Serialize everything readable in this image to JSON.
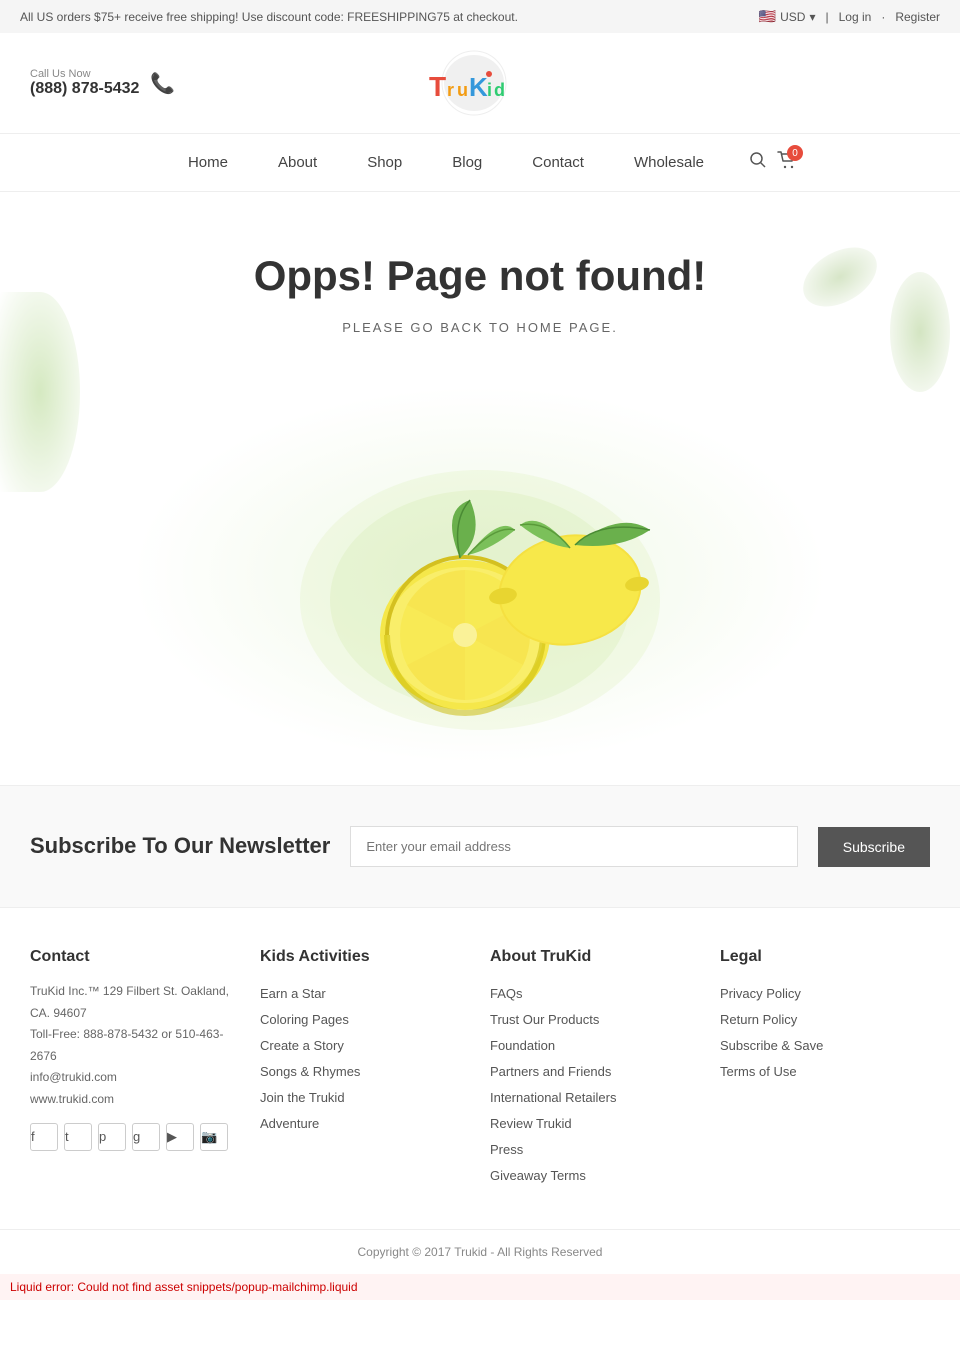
{
  "topbar": {
    "promo_text": "All US orders $75+ receive free shipping! Use discount code: FREESHIPPING75 at checkout.",
    "currency": "USD",
    "login_label": "Log in",
    "register_label": "Register"
  },
  "header": {
    "call_label": "Call Us Now",
    "phone": "(888) 878-5432"
  },
  "nav": {
    "items": [
      {
        "label": "Home",
        "href": "#"
      },
      {
        "label": "About",
        "href": "#"
      },
      {
        "label": "Shop",
        "href": "#"
      },
      {
        "label": "Blog",
        "href": "#"
      },
      {
        "label": "Contact",
        "href": "#"
      },
      {
        "label": "Wholesale",
        "href": "#"
      }
    ],
    "cart_count": "0"
  },
  "error_page": {
    "title": "Opps! Page not found!",
    "subtitle": "PLEASE GO BACK TO HOME PAGE."
  },
  "newsletter": {
    "title": "Subscribe To Our Newsletter",
    "input_placeholder": "Enter your email address",
    "button_label": "Subscribe"
  },
  "footer": {
    "contact": {
      "heading": "Contact",
      "address": "TruKid Inc.™ 129 Filbert St. Oakland, CA. 94607",
      "tollfree": "Toll-Free: 888-878-5432 or 510-463-2676",
      "email": "info@trukid.com",
      "website": "www.trukid.com"
    },
    "kids_activities": {
      "heading": "Kids Activities",
      "links": [
        "Earn a Star",
        "Coloring Pages",
        "Create a Story",
        "Songs & Rhymes",
        "Join the Trukid",
        "Adventure"
      ]
    },
    "about_trukid": {
      "heading": "About TruKid",
      "links": [
        "FAQs",
        "Trust Our Products",
        "Foundation",
        "Partners and Friends",
        "International Retailers",
        "Review Trukid",
        "Press",
        "Giveaway Terms"
      ]
    },
    "legal": {
      "heading": "Legal",
      "links": [
        "Privacy Policy",
        "Return Policy",
        "Subscribe & Save",
        "Terms of Use"
      ]
    }
  },
  "copyright": {
    "text": "Copyright © 2017 Trukid - All Rights Reserved"
  },
  "liquid_error": {
    "text": "Liquid error: Could not find asset snippets/popup-mailchimp.liquid"
  }
}
